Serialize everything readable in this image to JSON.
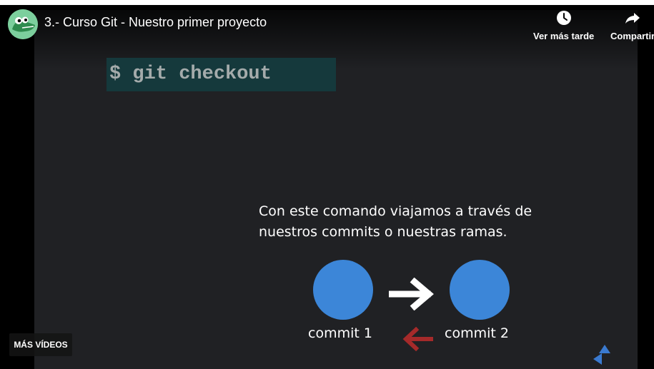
{
  "video": {
    "title": "3.- Curso Git - Nuestro primer proyecto"
  },
  "actions": {
    "watch_later": "Ver más tarde",
    "share": "Compartir"
  },
  "slide": {
    "code": "$ git checkout",
    "text_line1": "Con este comando viajamos a través de",
    "text_line2": "nuestros commits o nuestras ramas.",
    "commit1": "commit 1",
    "commit2": "commit 2"
  },
  "more_videos": "MÁS VÍDEOS",
  "colors": {
    "slide_bg": "#202124",
    "code_bg": "#15393c",
    "commit_blue": "#3c86d8",
    "arrow_red": "#a52a2a",
    "logo_blue": "#3a7ad0"
  }
}
